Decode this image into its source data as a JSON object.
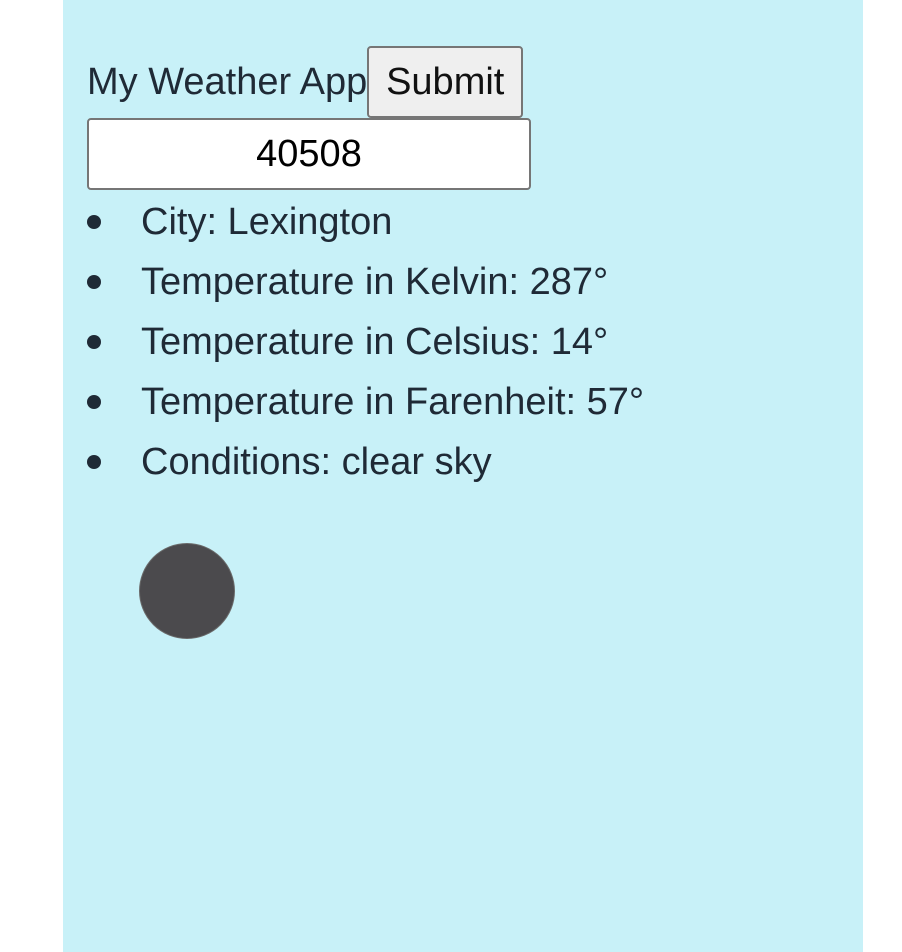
{
  "app": {
    "title": "My Weather App",
    "submit_label": "Submit",
    "zip_value": "40508"
  },
  "weather": {
    "items": [
      {
        "label": "City: Lexington"
      },
      {
        "label": "Temperature in Kelvin: 287°"
      },
      {
        "label": "Temperature in Celsius: 14°"
      },
      {
        "label": "Temperature in Farenheit: 57°"
      },
      {
        "label": "Conditions: clear sky"
      }
    ],
    "icon": "weather-condition-icon"
  },
  "colors": {
    "panel_background": "#c8f1f8",
    "text": "#1f2a36",
    "icon_fill": "#4b4a4d"
  }
}
